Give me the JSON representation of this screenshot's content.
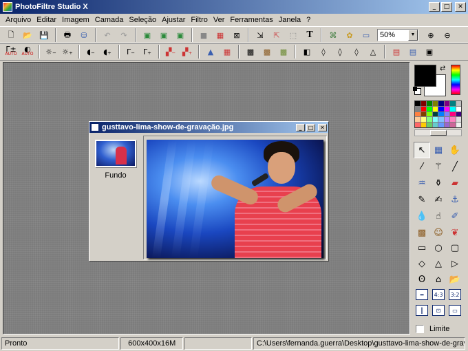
{
  "app": {
    "title": "PhotoFiltre Studio X"
  },
  "menu": [
    "Arquivo",
    "Editar",
    "Imagem",
    "Camada",
    "Seleção",
    "Ajustar",
    "Filtro",
    "Ver",
    "Ferramentas",
    "Janela",
    "?"
  ],
  "toolbar1": {
    "zoom_value": "50%"
  },
  "toolbar2": {
    "auto_label_1": "AUTO",
    "auto_label_2": "AUTO"
  },
  "document": {
    "title": "gusttavo-lima-show-de-gravação.jpg",
    "layer_name": "Fundo"
  },
  "tools": {
    "limit_label": "Limite",
    "ratio_43": "4:3",
    "ratio_32": "3:2"
  },
  "status": {
    "state": "Pronto",
    "dimensions": "600x400x16M",
    "path": "C:\\Users\\fernanda.guerra\\Desktop\\gusttavo-lima-show-de-grav"
  },
  "palette_colors": [
    "#000000",
    "#800000",
    "#008000",
    "#808000",
    "#000080",
    "#800080",
    "#008080",
    "#c0c0c0",
    "#808080",
    "#ff0000",
    "#00ff00",
    "#ffff00",
    "#0000ff",
    "#ff00ff",
    "#00ffff",
    "#ffffff",
    "#ff8040",
    "#804000",
    "#80ff00",
    "#004040",
    "#0080ff",
    "#8080ff",
    "#ff0080",
    "#400080",
    "#ffcc99",
    "#ffff80",
    "#80ff80",
    "#80ffff",
    "#80c0ff",
    "#c080ff",
    "#ff80c0",
    "#e0e0e0",
    "#ff6666",
    "#ffcc00",
    "#66cc66",
    "#66cccc",
    "#6699ff",
    "#9966cc",
    "#cc6699",
    "#f0f0f0"
  ]
}
